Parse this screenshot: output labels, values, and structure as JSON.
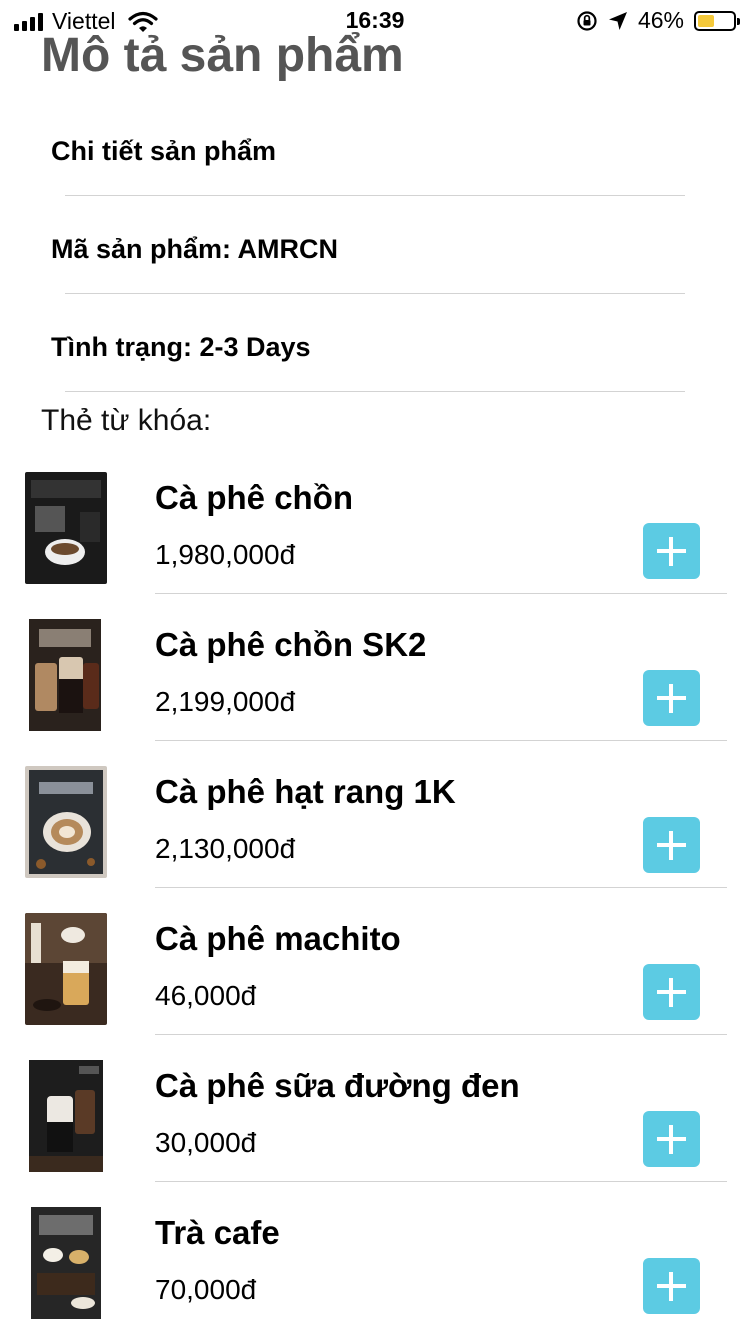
{
  "status_bar": {
    "carrier": "Viettel",
    "time": "16:39",
    "battery_percent": "46%",
    "battery_level": 0.46,
    "icons": [
      "signal-icon",
      "wifi-icon",
      "rotation-lock-icon",
      "location-icon",
      "battery-icon"
    ]
  },
  "page": {
    "title": "Mô tả sản phẩm"
  },
  "details": {
    "heading": "Chi tiết sản phẩm",
    "sku": "Mã sản phẩm: AMRCN",
    "status": "Tình trạng: 2-3 Days"
  },
  "tags_label": "Thẻ từ khóa:",
  "colors": {
    "accent": "#5ccbe3",
    "title": "#555555",
    "divider": "#d3d3d3"
  },
  "products": [
    {
      "name": "Cà phê chồn",
      "price": "1,980,000đ"
    },
    {
      "name": "Cà phê chồn SK2",
      "price": "2,199,000đ"
    },
    {
      "name": "Cà phê hạt rang 1K",
      "price": "2,130,000đ"
    },
    {
      "name": "Cà phê machito",
      "price": "46,000đ"
    },
    {
      "name": "Cà phê sữa đường đen",
      "price": "30,000đ"
    },
    {
      "name": "Trà cafe",
      "price": "70,000đ"
    }
  ]
}
